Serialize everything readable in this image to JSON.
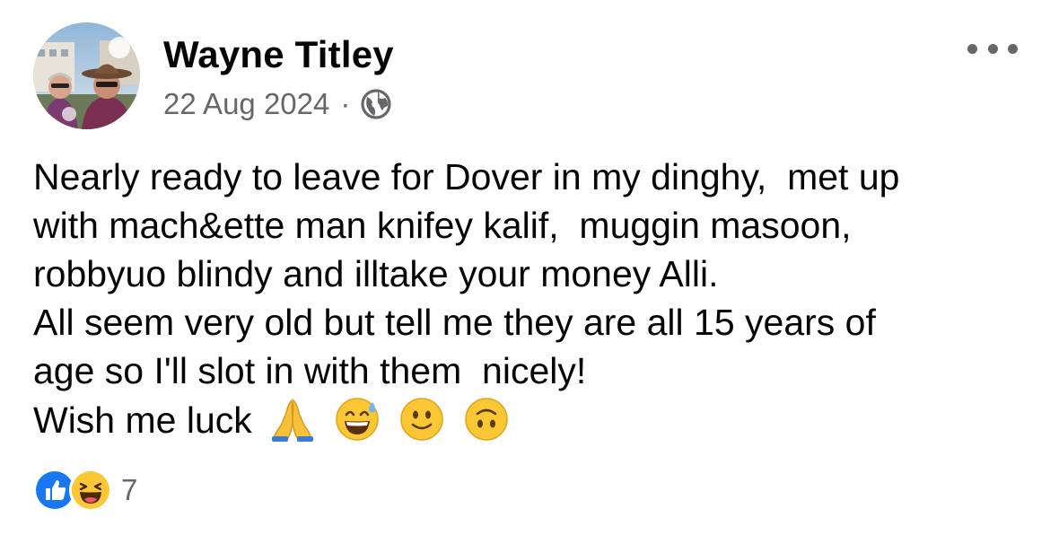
{
  "post": {
    "author": "Wayne Titley",
    "date": "22 Aug 2024",
    "separator": "·",
    "audience_icon": "globe-icon",
    "more_icon": "more-options-icon"
  },
  "body": {
    "lines": [
      "Nearly ready to leave for Dover in my dinghy,  met up",
      "with mach&ette man knifey kalif,  muggin masoon,",
      "robbyuo blindy and illtake your money Alli.",
      "All seem very old but tell me they are all 15 years of",
      "age so I'll slot in with them  nicely!",
      "Wish me luck"
    ],
    "emojis": [
      "folded-hands-emoji",
      "grinning-sweat-emoji",
      "slightly-smiling-emoji",
      "upside-down-face-emoji"
    ]
  },
  "reactions": {
    "icons": [
      "like-icon",
      "haha-icon"
    ],
    "count": "7",
    "like_color": "#1877f2"
  }
}
